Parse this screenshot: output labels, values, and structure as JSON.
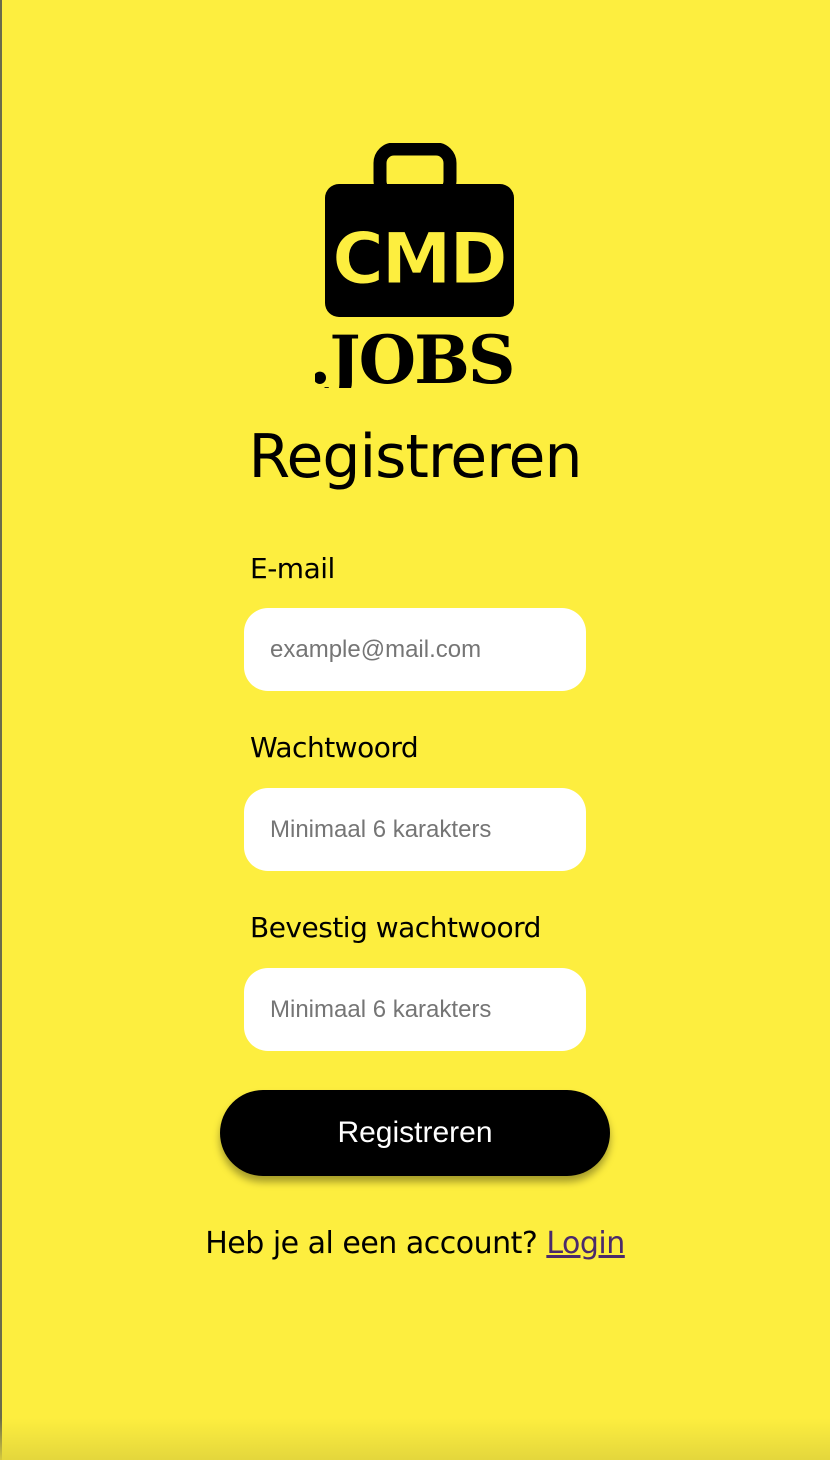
{
  "brand": {
    "logo_top_text": "CMD",
    "logo_bottom_text": ".JOBS",
    "icon": "briefcase-icon"
  },
  "page": {
    "title": "Registreren"
  },
  "form": {
    "email": {
      "label": "E-mail",
      "placeholder": "example@mail.com"
    },
    "password": {
      "label": "Wachtwoord",
      "placeholder": "Minimaal 6 karakters"
    },
    "confirm_password": {
      "label": "Bevestig wachtwoord",
      "placeholder": "Minimaal 6 karakters"
    },
    "submit_label": "Registreren"
  },
  "footer": {
    "prompt": "Heb je al een account? ",
    "login_link": "Login"
  },
  "colors": {
    "background": "#fdee3f",
    "button": "#000000",
    "link": "#4b2a6b"
  }
}
